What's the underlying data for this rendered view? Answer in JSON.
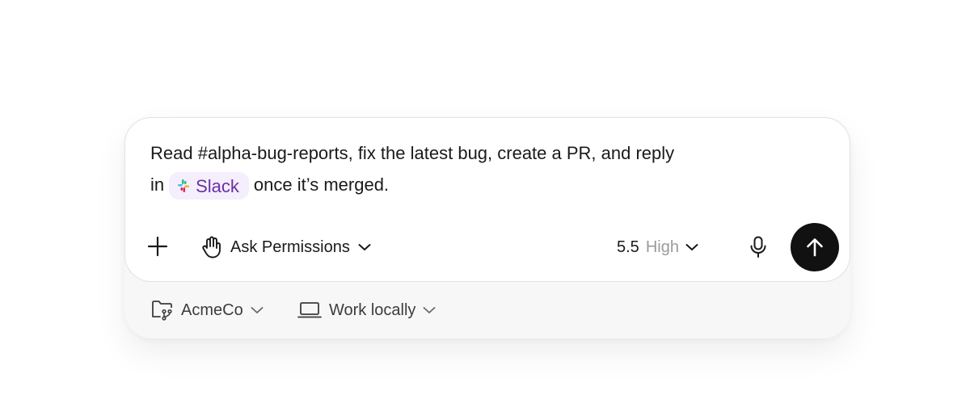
{
  "composer": {
    "prompt_line1": "Read #alpha-bug-reports, fix the latest bug, create a PR, and reply",
    "prompt_line2_prefix": "in",
    "mention_label": "Slack",
    "prompt_line2_suffix": "once it’s merged."
  },
  "toolbar": {
    "add_icon": "plus-icon",
    "permissions_icon": "hand-icon",
    "permissions_label": "Ask Permissions",
    "model_version": "5.5",
    "model_level": "High",
    "mic_icon": "microphone-icon",
    "send_icon": "arrow-up-icon"
  },
  "footer": {
    "repo_label": "AcmeCo",
    "repo_icon": "folder-branch-icon",
    "environment_label": "Work locally",
    "environment_icon": "laptop-icon"
  },
  "colors": {
    "mention_bg": "#f5eefc",
    "mention_text": "#6b2fa3",
    "send_button": "#111111",
    "muted_text": "#9a9a9a"
  }
}
